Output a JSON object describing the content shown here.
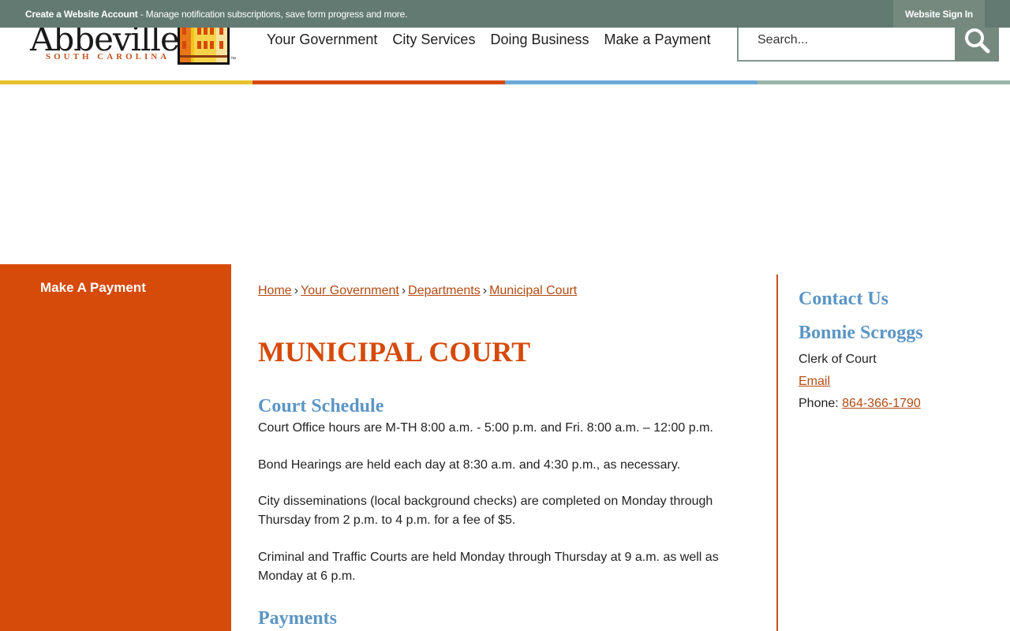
{
  "topbar": {
    "account_link": "Create a Website Account",
    "account_desc": " - Manage notification subscriptions, save form progress and more.",
    "sign_in": "Website Sign In"
  },
  "logo": {
    "name": "Abbeville",
    "subtitle": "SOUTH CAROLINA",
    "tm": "™"
  },
  "nav": {
    "items": [
      "Your Government",
      "City Services",
      "Doing Business",
      "Make a Payment"
    ]
  },
  "search": {
    "placeholder": "Search..."
  },
  "colors": {
    "stripe_yellow": "#e8c12e",
    "stripe_orange": "#d64a0a",
    "stripe_blue": "#6aa9d8",
    "stripe_sage": "#9ab5aa",
    "accent_orange": "#d64a0a",
    "heading_blue": "#5b95c5"
  },
  "sidebar": {
    "items": [
      "Make A Payment"
    ]
  },
  "breadcrumb": {
    "items": [
      "Home",
      "Your Government",
      "Departments",
      "Municipal Court"
    ],
    "separator": "›"
  },
  "main": {
    "title": "MUNICIPAL COURT",
    "schedule_heading": "Court Schedule",
    "paragraphs": [
      "Court Office hours are M-TH 8:00 a.m. - 5:00 p.m. and Fri. 8:00 a.m. – 12:00 p.m.",
      "Bond Hearings are held each day at 8:30 a.m. and 4:30 p.m., as necessary.",
      "City disseminations (local background checks) are completed on Monday through Thursday from 2 p.m. to 4 p.m. for a fee of $5.",
      "Criminal and Traffic Courts are held Monday through Thursday at 9 a.m. as well as Monday at 6 p.m."
    ],
    "payments_heading": "Payments"
  },
  "contact": {
    "heading": "Contact Us",
    "name": "Bonnie Scroggs",
    "role": "Clerk of Court",
    "email_label": "Email",
    "phone_label": "Phone: ",
    "phone": "864-366-1790"
  }
}
